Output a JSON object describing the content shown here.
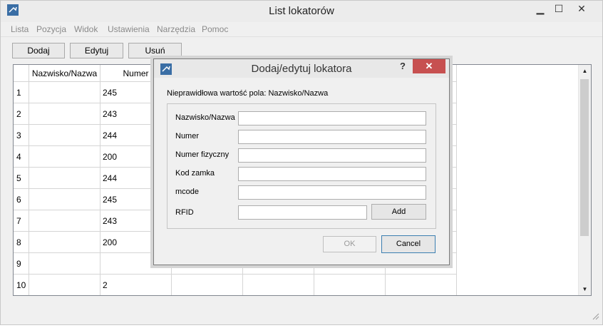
{
  "window": {
    "title": "List lokatorów",
    "minimize": "▁",
    "maximize": "☐",
    "close": "✕"
  },
  "menu": [
    "Lista",
    "Pozycja",
    "Widok",
    "Ustawienia",
    "Narzędzia",
    "Pomoc"
  ],
  "toolbar": {
    "add": "Dodaj",
    "edit": "Edytuj",
    "delete": "Usuń"
  },
  "table": {
    "headers": [
      "Nazwisko/Nazwa",
      "Numer"
    ],
    "rows": [
      {
        "n": "1",
        "name": "",
        "number": "245"
      },
      {
        "n": "2",
        "name": "",
        "number": "243"
      },
      {
        "n": "3",
        "name": "",
        "number": "244"
      },
      {
        "n": "4",
        "name": "",
        "number": "200"
      },
      {
        "n": "5",
        "name": "",
        "number": "244"
      },
      {
        "n": "6",
        "name": "",
        "number": "245"
      },
      {
        "n": "7",
        "name": "",
        "number": "243"
      },
      {
        "n": "8",
        "name": "",
        "number": "200"
      },
      {
        "n": "9",
        "name": "",
        "number": ""
      },
      {
        "n": "10",
        "name": "",
        "number": "2"
      }
    ]
  },
  "dialog": {
    "title": "Dodaj/edytuj lokatora",
    "help": "?",
    "close": "✕",
    "error": "Nieprawidłowa wartość pola: Nazwisko/Nazwa",
    "fields": [
      {
        "label": "Nazwisko/Nazwa",
        "value": ""
      },
      {
        "label": "Numer",
        "value": ""
      },
      {
        "label": "Numer fizyczny",
        "value": ""
      },
      {
        "label": "Kod zamka",
        "value": ""
      },
      {
        "label": "mcode",
        "value": ""
      },
      {
        "label": "RFID",
        "value": ""
      }
    ],
    "add_button": "Add",
    "ok": "OK",
    "cancel": "Cancel"
  },
  "colors": {
    "close_red": "#c75050",
    "focus_border": "#3c7fb1",
    "disabled_text": "#9a9a9a"
  }
}
